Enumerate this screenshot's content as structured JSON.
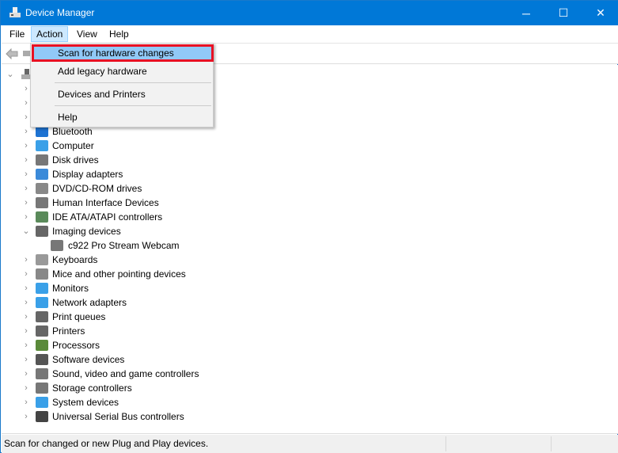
{
  "window": {
    "title": "Device Manager",
    "minimize": "─",
    "maximize": "☐",
    "close": "✕"
  },
  "menubar": [
    "File",
    "Action",
    "View",
    "Help"
  ],
  "action_menu": {
    "items": [
      "Scan for hardware changes",
      "Add legacy hardware",
      "Devices and Printers",
      "Help"
    ],
    "highlighted": "Scan for hardware changes",
    "highlight_color": "#e81123"
  },
  "tree": {
    "items": [
      {
        "label": "Bluetooth",
        "icon": "bluetooth-icon",
        "color": "#1e73d2"
      },
      {
        "label": "Computer",
        "icon": "computer-icon",
        "color": "#3aa0e8"
      },
      {
        "label": "Disk drives",
        "icon": "disk-drive-icon",
        "color": "#777"
      },
      {
        "label": "Display adapters",
        "icon": "display-adapter-icon",
        "color": "#3b8ad9"
      },
      {
        "label": "DVD/CD-ROM drives",
        "icon": "dvd-icon",
        "color": "#888"
      },
      {
        "label": "Human Interface Devices",
        "icon": "hid-icon",
        "color": "#777"
      },
      {
        "label": "IDE ATA/ATAPI controllers",
        "icon": "ide-controller-icon",
        "color": "#5a8a5a"
      },
      {
        "label": "Imaging devices",
        "icon": "camera-icon",
        "color": "#666",
        "expanded": true,
        "children": [
          "c922 Pro Stream Webcam"
        ]
      },
      {
        "label": "Keyboards",
        "icon": "keyboard-icon",
        "color": "#999"
      },
      {
        "label": "Mice and other pointing devices",
        "icon": "mouse-icon",
        "color": "#888"
      },
      {
        "label": "Monitors",
        "icon": "monitor-icon",
        "color": "#3aa0e8"
      },
      {
        "label": "Network adapters",
        "icon": "network-adapter-icon",
        "color": "#3aa0e8"
      },
      {
        "label": "Print queues",
        "icon": "print-queue-icon",
        "color": "#666"
      },
      {
        "label": "Printers",
        "icon": "printer-icon",
        "color": "#666"
      },
      {
        "label": "Processors",
        "icon": "processor-icon",
        "color": "#5a8a3a"
      },
      {
        "label": "Software devices",
        "icon": "software-device-icon",
        "color": "#555"
      },
      {
        "label": "Sound, video and game controllers",
        "icon": "speaker-icon",
        "color": "#777"
      },
      {
        "label": "Storage controllers",
        "icon": "storage-controller-icon",
        "color": "#777"
      },
      {
        "label": "System devices",
        "icon": "system-devices-icon",
        "color": "#3aa0e8"
      },
      {
        "label": "Universal Serial Bus controllers",
        "icon": "usb-icon",
        "color": "#444"
      }
    ]
  },
  "status": {
    "text": "Scan for changed or new Plug and Play devices."
  },
  "colors": {
    "titlebar": "#0078d7",
    "menu_highlight": "#91c9f7"
  }
}
